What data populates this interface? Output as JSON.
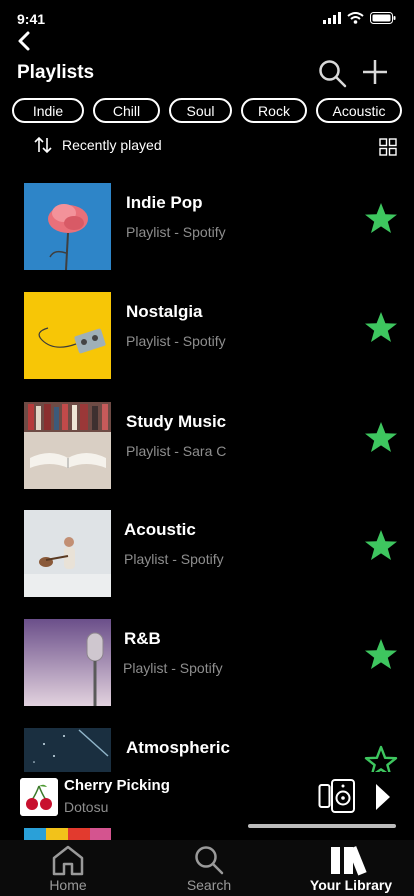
{
  "status_bar": {
    "time": "9:41"
  },
  "header": {
    "title": "Playlists"
  },
  "filters": [
    "Indie",
    "Chill",
    "Soul",
    "Rock",
    "Acoustic"
  ],
  "sort": {
    "label": "Recently played"
  },
  "playlists": [
    {
      "title": "Indie Pop",
      "subtitle": "Playlist - Spotify",
      "favorited": true
    },
    {
      "title": "Nostalgia",
      "subtitle": "Playlist - Spotify",
      "favorited": true
    },
    {
      "title": "Study Music",
      "subtitle": "Playlist - Sara C",
      "favorited": true
    },
    {
      "title": "Acoustic",
      "subtitle": "Playlist - Spotify",
      "favorited": true
    },
    {
      "title": "R&B",
      "subtitle": "Playlist - Spotify",
      "favorited": true
    },
    {
      "title": "Atmospheric",
      "subtitle": "",
      "favorited": false
    }
  ],
  "now_playing": {
    "title": "Cherry Picking",
    "artist": "Dotosu",
    "progress": 0
  },
  "tabs": [
    {
      "label": "Home",
      "icon": "home-icon",
      "active": false
    },
    {
      "label": "Search",
      "icon": "search-icon",
      "active": false
    },
    {
      "label": "Your Library",
      "icon": "library-icon",
      "active": true
    }
  ],
  "colors": {
    "accent_green": "#3ec65f",
    "background": "#000000",
    "secondary_text": "#8e8e8e"
  }
}
